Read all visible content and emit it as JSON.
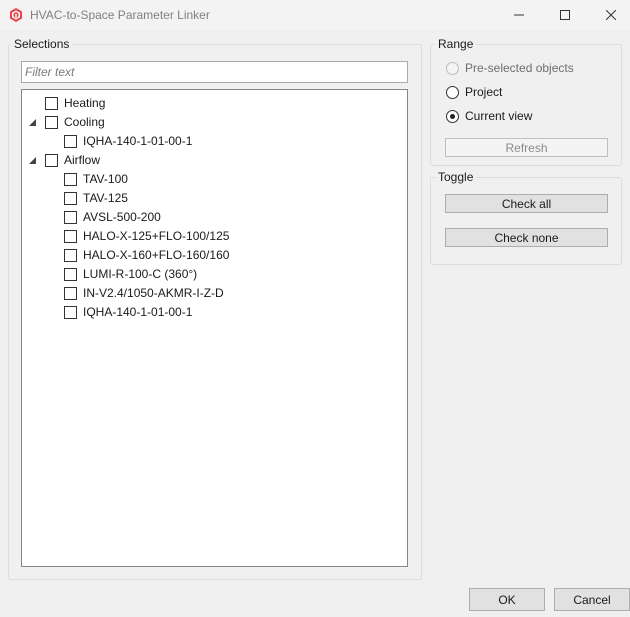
{
  "window": {
    "title": "HVAC-to-Space Parameter Linker",
    "accent_color": "#e8464a"
  },
  "selections": {
    "group_label": "Selections",
    "filter_placeholder": "Filter text",
    "tree": [
      {
        "label": "Heating",
        "level": 0,
        "has_children": false,
        "checked": false
      },
      {
        "label": "Cooling",
        "level": 0,
        "has_children": true,
        "expanded": true,
        "checked": false
      },
      {
        "label": "IQHA-140-1-01-00-1",
        "level": 1,
        "checked": false
      },
      {
        "label": "Airflow",
        "level": 0,
        "has_children": true,
        "expanded": true,
        "checked": false
      },
      {
        "label": "TAV-100",
        "level": 1,
        "checked": false
      },
      {
        "label": "TAV-125",
        "level": 1,
        "checked": false
      },
      {
        "label": "AVSL-500-200",
        "level": 1,
        "checked": false
      },
      {
        "label": "HALO-X-125+FLO-100/125",
        "level": 1,
        "checked": false
      },
      {
        "label": "HALO-X-160+FLO-160/160",
        "level": 1,
        "checked": false
      },
      {
        "label": "LUMI-R-100-C (360°)",
        "level": 1,
        "checked": false
      },
      {
        "label": "IN-V2.4/1050-AKMR-I-Z-D",
        "level": 1,
        "checked": false
      },
      {
        "label": "IQHA-140-1-01-00-1",
        "level": 1,
        "checked": false
      }
    ]
  },
  "range": {
    "group_label": "Range",
    "options": [
      {
        "label": "Pre-selected objects",
        "enabled": false,
        "checked": false
      },
      {
        "label": "Project",
        "enabled": true,
        "checked": false
      },
      {
        "label": "Current view",
        "enabled": true,
        "checked": true
      }
    ],
    "refresh_label": "Refresh"
  },
  "toggle": {
    "group_label": "Toggle",
    "check_all_label": "Check all",
    "check_none_label": "Check none"
  },
  "footer": {
    "ok_label": "OK",
    "cancel_label": "Cancel"
  }
}
